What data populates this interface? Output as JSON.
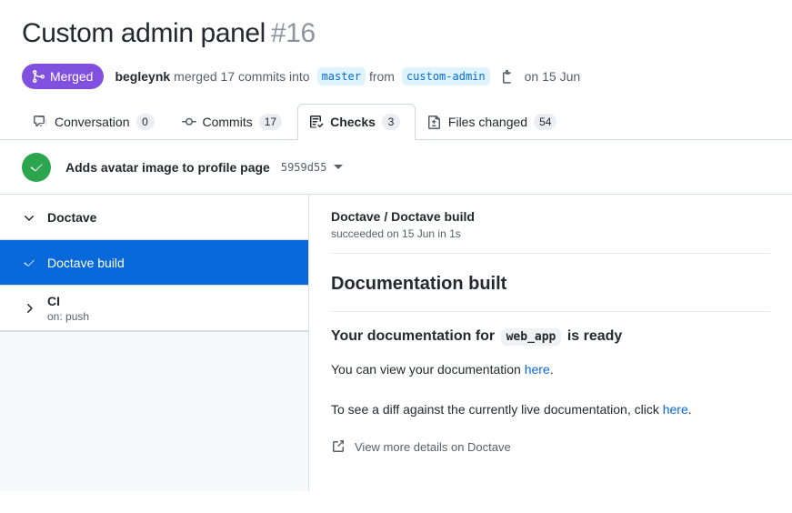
{
  "pull_request": {
    "title": "Custom admin panel",
    "number": "#16",
    "state_label": "Merged",
    "state_color": "#8250df",
    "author": "begleynk",
    "merged_text": "merged 17 commits into",
    "base_branch": "master",
    "from_text": "from",
    "head_branch": "custom-admin",
    "merged_date": "on 15 Jun"
  },
  "tabs": [
    {
      "label": "Conversation",
      "count": "0",
      "icon": "comment-discussion-icon",
      "selected": false
    },
    {
      "label": "Commits",
      "count": "17",
      "icon": "git-commit-icon",
      "selected": false
    },
    {
      "label": "Checks",
      "count": "3",
      "icon": "checklist-icon",
      "selected": true
    },
    {
      "label": "Files changed",
      "count": "54",
      "icon": "file-diff-icon",
      "selected": false
    }
  ],
  "commit_bar": {
    "status_icon": "check-circle-icon",
    "status_color": "#2da44e",
    "title": "Adds avatar image to profile page",
    "sha": "5959d55"
  },
  "sidebar": {
    "groups": [
      {
        "name": "Doctave",
        "expanded": true,
        "subtitle": "",
        "checks": [
          {
            "name": "Doctave build",
            "status": "success",
            "selected": true
          }
        ]
      },
      {
        "name": "CI",
        "expanded": false,
        "subtitle": "on: push",
        "checks": []
      }
    ]
  },
  "check_detail": {
    "breadcrumb_owner": "Doctave",
    "breadcrumb_separator": "/",
    "breadcrumb_name": "Doctave build",
    "status_line": "succeeded on 15 Jun in 1s",
    "annotation_title": "Documentation built",
    "summary_prefix": "Your documentation for",
    "summary_code": "web_app",
    "summary_suffix": "is ready",
    "paragraph_1_pre": "You can view your documentation ",
    "paragraph_1_link": "here",
    "paragraph_1_post": ".",
    "paragraph_2_pre": "To see a diff against the currently live documentation, click ",
    "paragraph_2_link": "here",
    "paragraph_2_post": ".",
    "external_link_label": "View more details on Doctave",
    "external_link_icon": "external-link-icon"
  }
}
